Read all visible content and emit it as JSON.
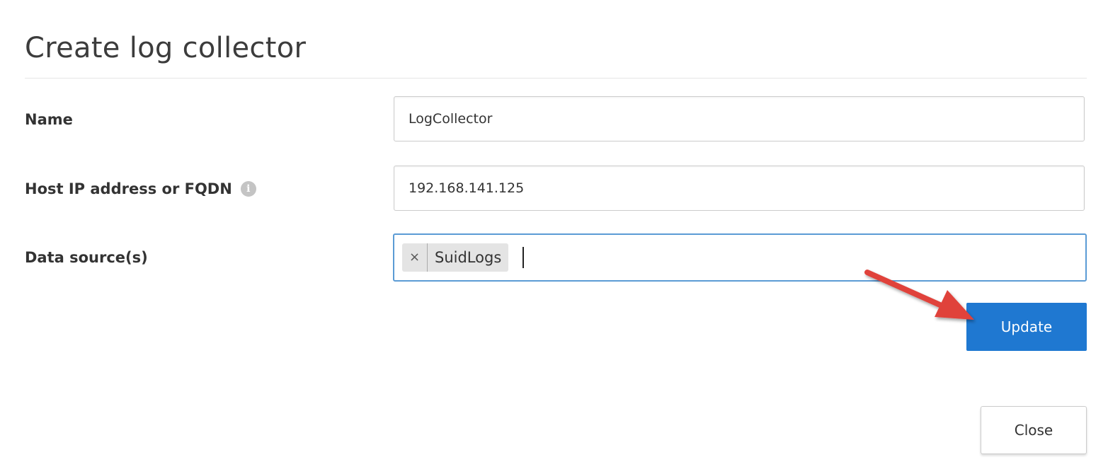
{
  "dialog": {
    "title": "Create log collector"
  },
  "form": {
    "name": {
      "label": "Name",
      "value": "LogCollector"
    },
    "host": {
      "label": "Host IP address or FQDN",
      "info_icon": "info-icon",
      "value": "192.168.141.125"
    },
    "data_sources": {
      "label": "Data source(s)",
      "tags": [
        {
          "remove_symbol": "×",
          "label": "SuidLogs"
        }
      ]
    }
  },
  "actions": {
    "update_label": "Update",
    "close_label": "Close"
  },
  "annotation": {
    "arrow_color": "#e0433b",
    "points_to": "update-button"
  },
  "colors": {
    "primary_button": "#1f78d1",
    "focus_border": "#5b9bd5",
    "tag_background": "#e4e4e4"
  }
}
